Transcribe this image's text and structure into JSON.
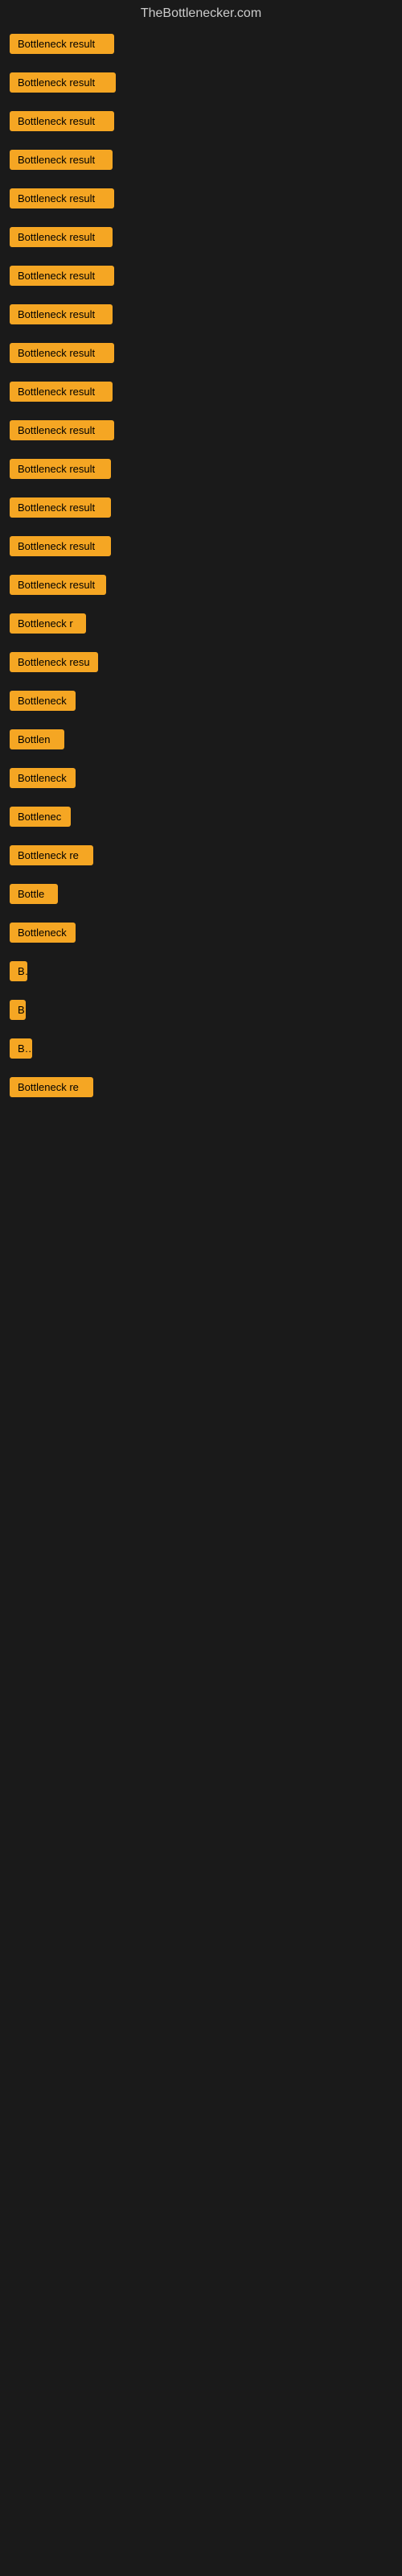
{
  "site": {
    "title": "TheBottlenecker.com"
  },
  "items": [
    {
      "label": "Bottleneck result",
      "width": 130
    },
    {
      "label": "Bottleneck result",
      "width": 132
    },
    {
      "label": "Bottleneck result",
      "width": 130
    },
    {
      "label": "Bottleneck result",
      "width": 128
    },
    {
      "label": "Bottleneck result",
      "width": 130
    },
    {
      "label": "Bottleneck result",
      "width": 128
    },
    {
      "label": "Bottleneck result",
      "width": 130
    },
    {
      "label": "Bottleneck result",
      "width": 128
    },
    {
      "label": "Bottleneck result",
      "width": 130
    },
    {
      "label": "Bottleneck result",
      "width": 128
    },
    {
      "label": "Bottleneck result",
      "width": 130
    },
    {
      "label": "Bottleneck result",
      "width": 126
    },
    {
      "label": "Bottleneck result",
      "width": 126
    },
    {
      "label": "Bottleneck result",
      "width": 126
    },
    {
      "label": "Bottleneck result",
      "width": 120
    },
    {
      "label": "Bottleneck r",
      "width": 95
    },
    {
      "label": "Bottleneck resu",
      "width": 110
    },
    {
      "label": "Bottleneck",
      "width": 82
    },
    {
      "label": "Bottlen",
      "width": 68
    },
    {
      "label": "Bottleneck",
      "width": 82
    },
    {
      "label": "Bottlenec",
      "width": 76
    },
    {
      "label": "Bottleneck re",
      "width": 104
    },
    {
      "label": "Bottle",
      "width": 60
    },
    {
      "label": "Bottleneck",
      "width": 82
    },
    {
      "label": "B",
      "width": 22
    },
    {
      "label": "B",
      "width": 18
    },
    {
      "label": "",
      "width": 8
    },
    {
      "label": "",
      "width": 4
    },
    {
      "label": "Bo",
      "width": 28
    },
    {
      "label": "",
      "width": 0
    },
    {
      "label": "",
      "width": 0
    },
    {
      "label": "",
      "width": 0
    },
    {
      "label": "Bottleneck re",
      "width": 104
    },
    {
      "label": "",
      "width": 0
    },
    {
      "label": "",
      "width": 0
    }
  ]
}
